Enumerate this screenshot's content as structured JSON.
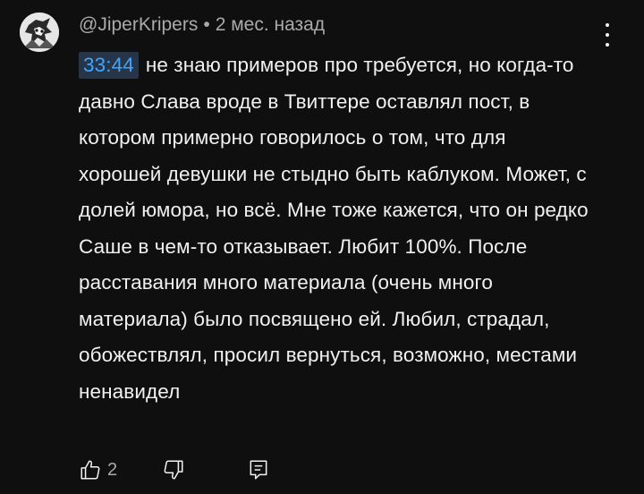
{
  "comment": {
    "author": "@JiperKripers",
    "separator": "•",
    "time_ago": "2 мес. назад",
    "timestamp_link": "33:44",
    "text": "не знаю примеров про требуется, но когда-то давно Слава вроде в Твиттере оставлял пост, в котором примерно говорилось о том, что для хорошей девушки не стыдно быть каблуком. Может, с долей юмора, но всё. Мне тоже кажется, что он редко Саше в чем-то отказывает. Любит 100%. После расставания много материала (очень много материала) было посвящено ей. Любил, страдал, обожествлял, просил вернуться, возможно, местами ненавидел",
    "like_count": "2",
    "icons": {
      "like": "thumb-up-icon",
      "dislike": "thumb-down-icon",
      "reply": "reply-icon",
      "more": "more-vert-icon"
    }
  },
  "colors": {
    "background": "#0f0f0f",
    "text": "#f1f1f1",
    "meta": "#aaaaaa",
    "timestamp_text": "#3ea6ff",
    "timestamp_bg": "#273549"
  }
}
